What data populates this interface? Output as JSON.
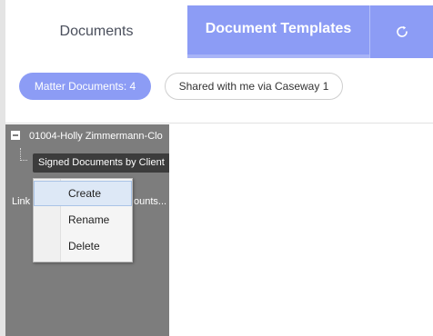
{
  "tabs": {
    "documents_label": "Documents",
    "templates_label": "Document Templates",
    "refresh_icon": "refresh-icon"
  },
  "filters": {
    "matter_label": "Matter Documents: 4",
    "shared_label": "Shared with me via Caseway 1"
  },
  "tree": {
    "root_label": "01004-Holly Zimmermann-Clo",
    "tooltip": "Signed Documents by Client",
    "child_left": "Link",
    "child_right": "ounts..."
  },
  "context_menu": {
    "items": [
      "Create",
      "Rename",
      "Delete"
    ]
  },
  "colors": {
    "accent": "#8c9cf5",
    "tree_bg": "#7d7d7d",
    "menu_highlight": "#dde8f6"
  }
}
